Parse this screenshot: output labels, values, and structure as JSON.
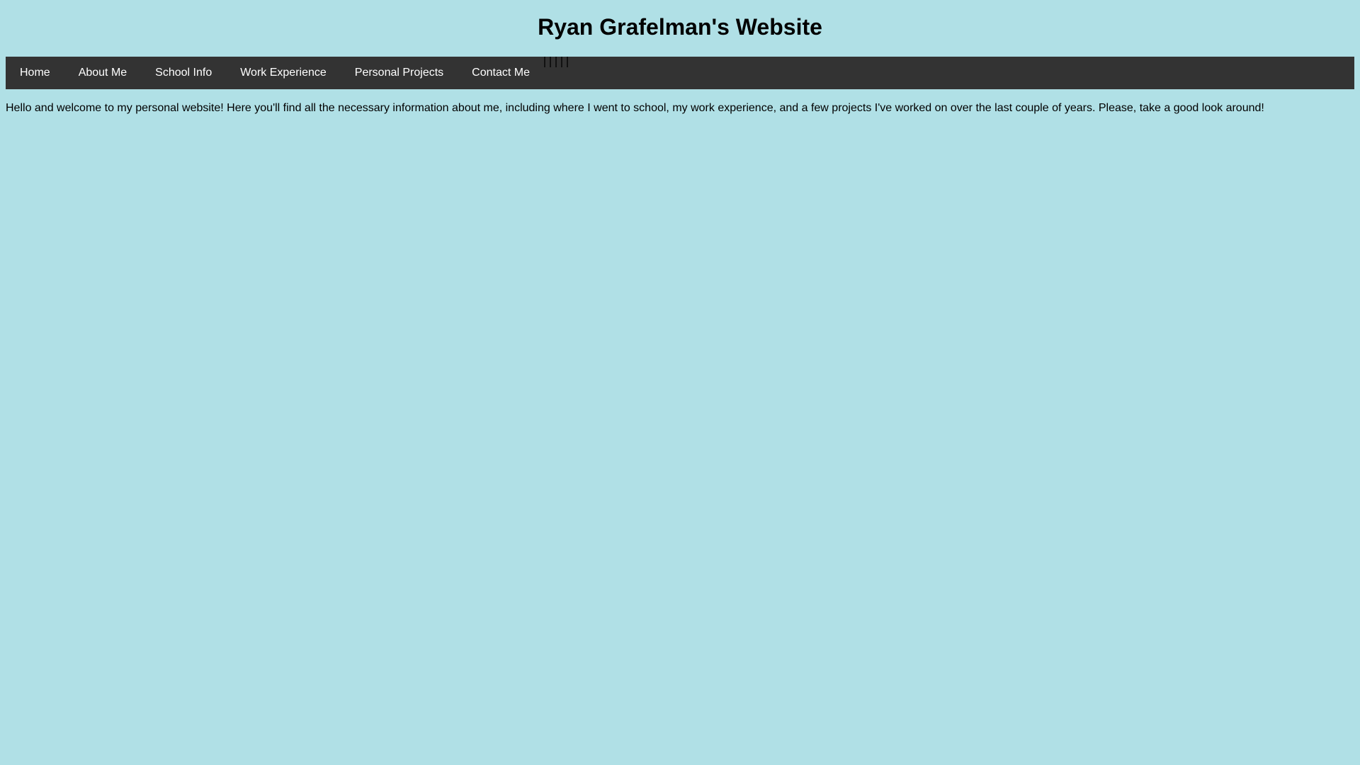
{
  "site": {
    "title": "Ryan Grafelman's Website"
  },
  "nav": {
    "items": [
      {
        "label": "Home"
      },
      {
        "label": "About Me"
      },
      {
        "label": "School Info"
      },
      {
        "label": "Work Experience"
      },
      {
        "label": "Personal Projects"
      },
      {
        "label": "Contact Me"
      }
    ],
    "separator_glyph": "|"
  },
  "content": {
    "intro": "Hello and welcome to my personal website! Here you'll find all the necessary information about me, including where I went to school, my work experience, and a few projects I've worked on over the last couple of years. Please, take a good look around!"
  },
  "colors": {
    "background": "#b0e0e6",
    "navbar": "#333333",
    "nav_text": "#ffffff",
    "body_text": "#000000"
  }
}
